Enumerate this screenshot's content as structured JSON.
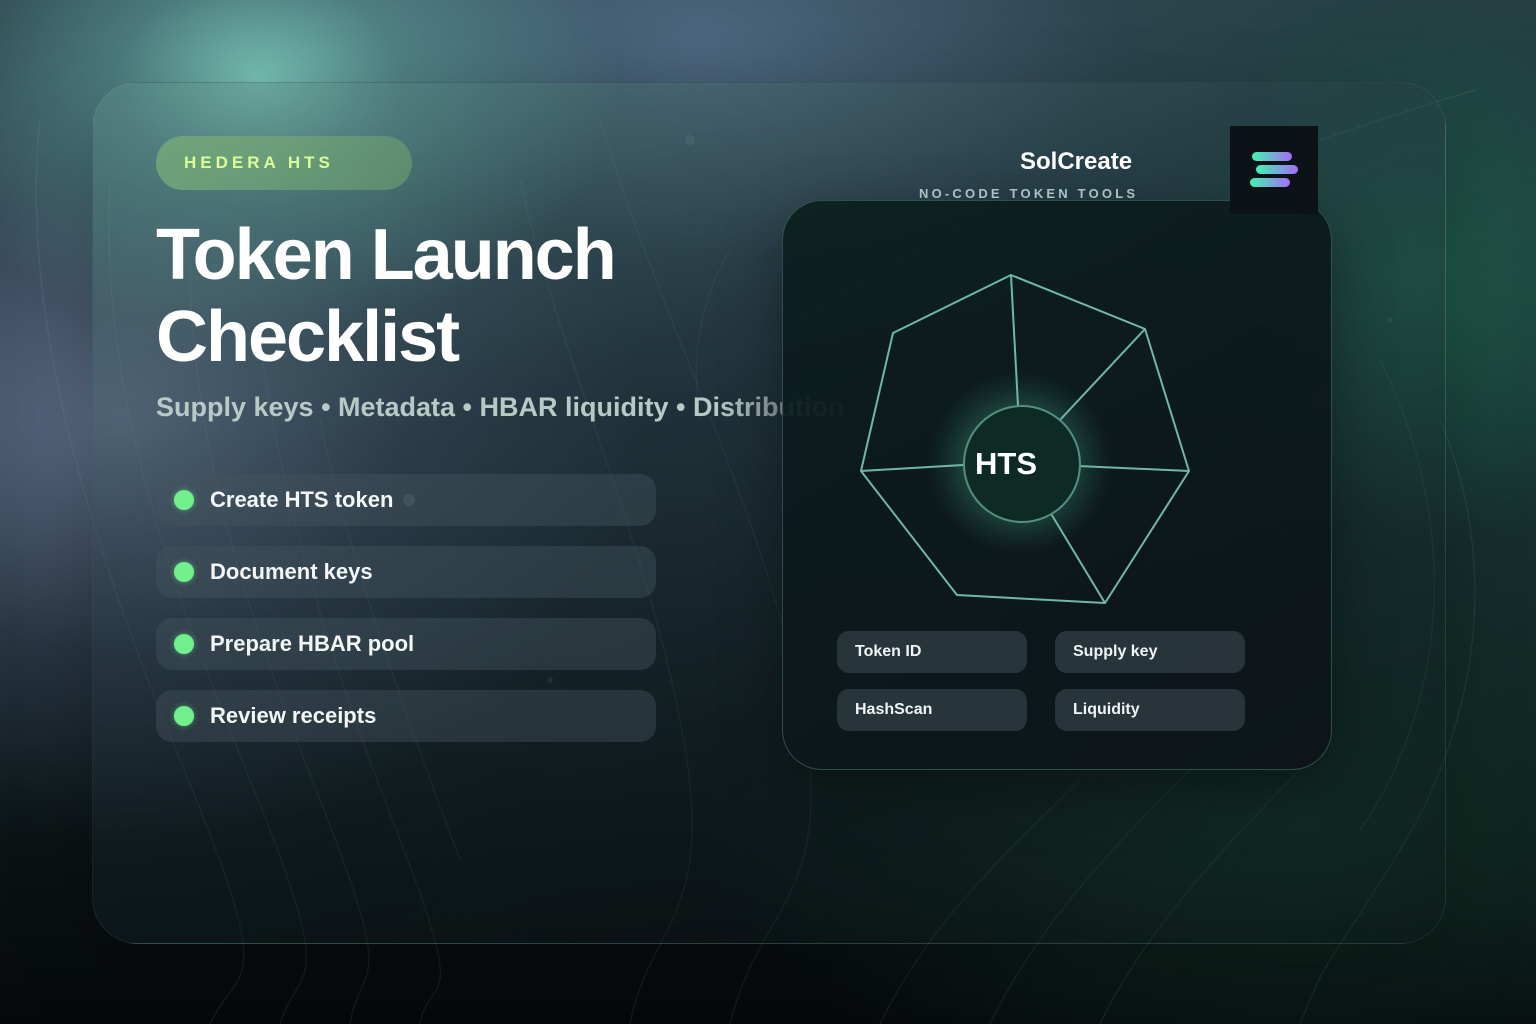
{
  "badge": {
    "label": "HEDERA HTS"
  },
  "hero": {
    "title_line1": "Token Launch",
    "title_line2": "Checklist",
    "subtitle": "Supply keys • Metadata • HBAR liquidity • Distribution"
  },
  "checklist": {
    "items": [
      {
        "label": "Create HTS token",
        "status_color": "#72f08e"
      },
      {
        "label": "Document keys",
        "status_color": "#72f08e"
      },
      {
        "label": "Prepare HBAR pool",
        "status_color": "#72f08e"
      },
      {
        "label": "Review receipts",
        "status_color": "#72f08e"
      }
    ]
  },
  "brand": {
    "name": "SolCreate",
    "tagline": "NO-CODE TOKEN TOOLS",
    "logo_icon": "solana-stripes-icon"
  },
  "panel": {
    "center_label": "HTS",
    "chips": [
      "Token ID",
      "Supply key",
      "HashScan",
      "Liquidity"
    ]
  },
  "colors": {
    "accent_green": "#72f08e",
    "badge_text": "#d8ff9c",
    "panel_stroke": "#6fb8a6"
  }
}
